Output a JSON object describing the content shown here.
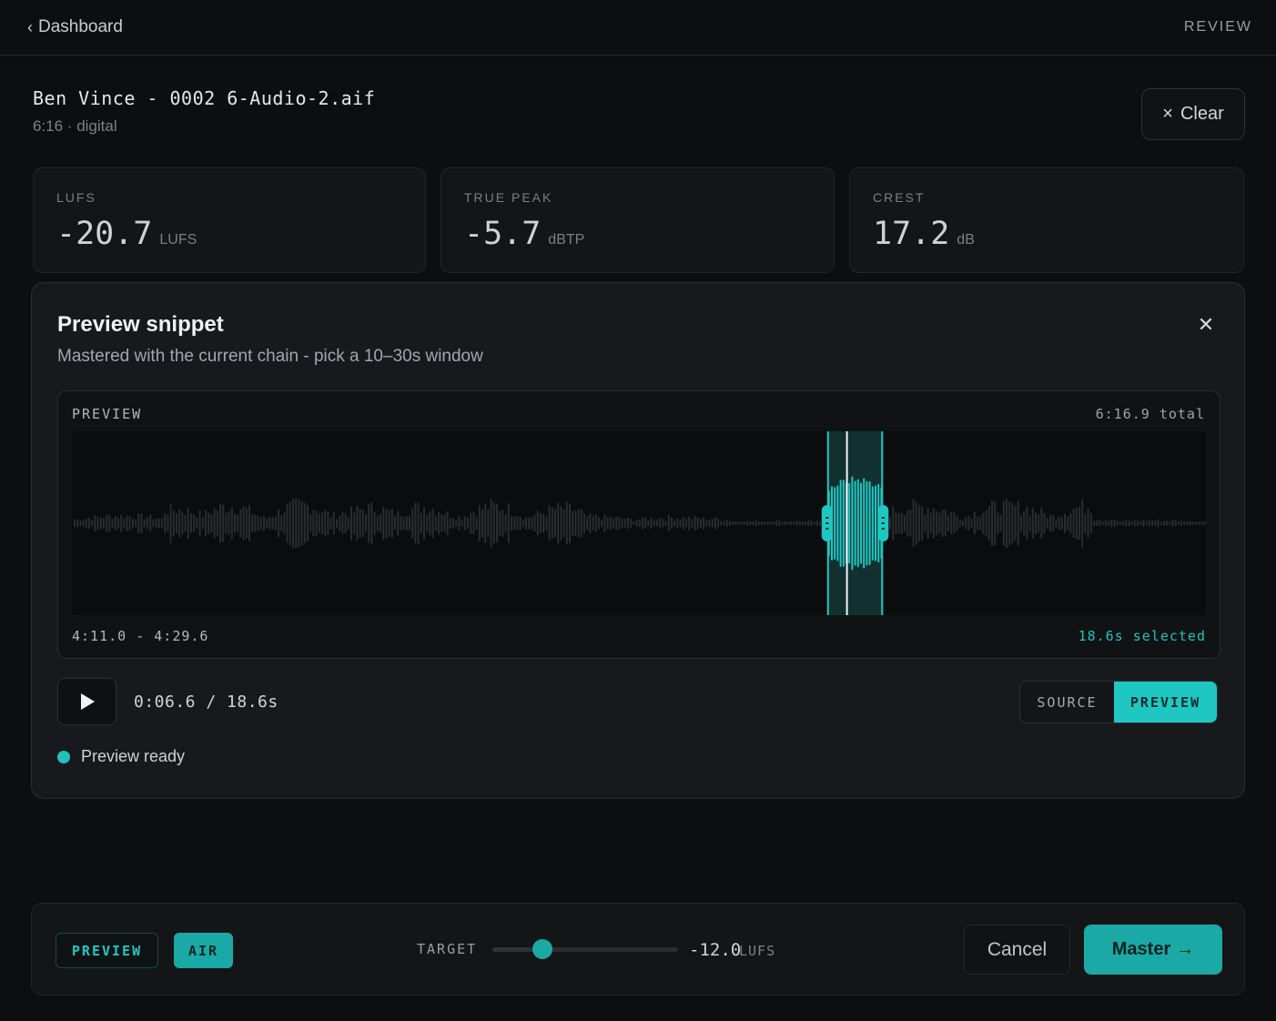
{
  "topbar": {
    "back_label": "Dashboard",
    "mode_label": "REVIEW"
  },
  "file": {
    "title": "Ben Vince - 0002 6-Audio-2.aif",
    "meta": "6:16 · digital",
    "clear_label": "Clear"
  },
  "metrics": [
    {
      "label": "LUFS",
      "value": "-20.7",
      "unit": "LUFS"
    },
    {
      "label": "TRUE PEAK",
      "value": "-5.7",
      "unit": "dBTP"
    },
    {
      "label": "CREST",
      "value": "17.2",
      "unit": "dB"
    }
  ],
  "preview_panel": {
    "title": "Preview snippet",
    "subtitle": "Mastered with the current chain - pick a 10–30s window",
    "waveform": {
      "label": "PREVIEW",
      "total": "6:16.9 total",
      "range": "4:11.0 - 4:29.6",
      "selected": "18.6s selected",
      "selection_start_sec": 251.0,
      "selection_end_sec": 269.6,
      "duration_sec": 376.9,
      "playhead_sec": 257.6
    },
    "transport": {
      "time": "0:06.6 / 18.6s"
    },
    "ab_toggle": {
      "source_label": "SOURCE",
      "preview_label": "PREVIEW",
      "active": "preview"
    },
    "status": "Preview ready"
  },
  "bottombar": {
    "chips": {
      "preview": "PREVIEW",
      "air": "AIR"
    },
    "target": {
      "label": "TARGET",
      "value": "-12.0",
      "unit": "LUFS",
      "slider_fraction": 0.27
    },
    "cancel_label": "Cancel",
    "master_label": "Master"
  },
  "colors": {
    "accent": "#1ec7c2",
    "accent_dark": "#1aa9a5",
    "background": "#0d0e10",
    "panel": "#18191c"
  },
  "icons": {
    "back": "chevron-left-icon",
    "clear": "close-icon",
    "close": "close-icon",
    "play": "play-icon",
    "master": "arrow-right-icon"
  }
}
